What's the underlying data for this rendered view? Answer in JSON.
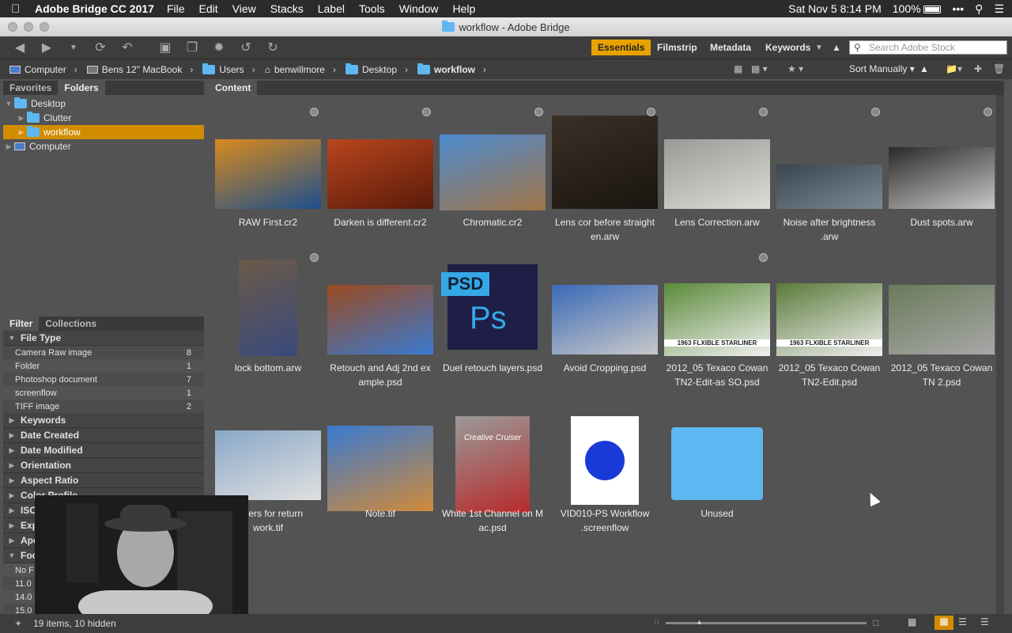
{
  "menubar": {
    "app_name": "Adobe Bridge CC 2017",
    "items": [
      "File",
      "Edit",
      "View",
      "Stacks",
      "Label",
      "Tools",
      "Window",
      "Help"
    ],
    "clock": "Sat Nov 5  8:14 PM",
    "battery": "100%"
  },
  "window": {
    "title": "workflow - Adobe Bridge"
  },
  "workspaces": {
    "essentials": "Essentials",
    "filmstrip": "Filmstrip",
    "metadata": "Metadata",
    "keywords": "Keywords"
  },
  "search": {
    "placeholder": "Search Adobe Stock"
  },
  "breadcrumbs": [
    "Computer",
    "Bens 12\" MacBook",
    "Users",
    "benwillmore",
    "Desktop",
    "workflow"
  ],
  "sort": {
    "label": "Sort Manually"
  },
  "left_panel": {
    "tabs": [
      "Favorites",
      "Folders"
    ],
    "tree": [
      "Desktop",
      "Clutter",
      "workflow",
      "Computer"
    ]
  },
  "filter_panel": {
    "tabs": [
      "Filter",
      "Collections"
    ],
    "file_type": {
      "title": "File Type",
      "rows": [
        {
          "label": "Camera Raw image",
          "count": "8"
        },
        {
          "label": "Folder",
          "count": "1"
        },
        {
          "label": "Photoshop document",
          "count": "7"
        },
        {
          "label": "screenflow",
          "count": "1"
        },
        {
          "label": "TIFF image",
          "count": "2"
        }
      ]
    },
    "sections": [
      "Keywords",
      "Date Created",
      "Date Modified",
      "Orientation",
      "Aspect Ratio",
      "Color Profile",
      "ISO Speed Ratings",
      "Exp",
      "Ape",
      "Foc"
    ],
    "focal_values": [
      "No F",
      "11.0",
      "14.0",
      "15.0"
    ]
  },
  "content": {
    "tab": "Content",
    "items": [
      {
        "name": "RAW First.cr2",
        "l2": "",
        "color": "#d98a1e",
        "color2": "#1d4f8c"
      },
      {
        "name": "Darken is different.cr2",
        "l2": "",
        "color": "#b8461d",
        "color2": "#5a1a0a"
      },
      {
        "name": "Chromatic.cr2",
        "l2": "",
        "color": "#4c8bd1",
        "color2": "#a27446"
      },
      {
        "name": "Lens cor before straight",
        "l2": "en.arw",
        "color": "#3b3026",
        "color2": "#1a1510"
      },
      {
        "name": "Lens Correction.arw",
        "l2": "",
        "color": "#9a9a96",
        "color2": "#dcdcd8"
      },
      {
        "name": "Noise after brightness",
        "l2": ".arw",
        "color": "#3a4550",
        "color2": "#7a8a95"
      },
      {
        "name": "Dust spots.arw",
        "l2": "",
        "color": "#2a2a2a",
        "color2": "#c8c8c8"
      },
      {
        "name": "lock bottom.arw",
        "l2": "",
        "color": "#6b5a48",
        "color2": "#3a4a7c"
      },
      {
        "name": "Retouch and Adj 2nd ex",
        "l2": "ample.psd",
        "color": "#9a4a20",
        "color2": "#3a7ad0"
      },
      {
        "name": "Duel retouch layers.psd",
        "l2": "",
        "color": "#1e1e46",
        "color2": "#35a8e8"
      },
      {
        "name": "Avoid Cropping.psd",
        "l2": "",
        "color": "#3a6ab8",
        "color2": "#c8c8c8"
      },
      {
        "name": "2012_05 Texaco Cowan",
        "l2": "TN2-Edit-as SO.psd",
        "color": "#5a8a3a",
        "color2": "#f0f0f0"
      },
      {
        "name": "2012_05 Texaco Cowan",
        "l2": "TN2-Edit.psd",
        "color": "#5a7a3a",
        "color2": "#f0f0f0"
      },
      {
        "name": "2012_05 Texaco Cowan",
        "l2": "TN 2.psd",
        "color": "#6a7a5a",
        "color2": "#a8a8a8"
      },
      {
        "name": "Layers for return",
        "l2": "work.tif",
        "color": "#8aa8c8",
        "color2": "#e0e0e0"
      },
      {
        "name": "Note.tif",
        "l2": "",
        "color": "#3a7ad0",
        "color2": "#d08a3a"
      },
      {
        "name": "White 1st Channel on M",
        "l2": "ac.psd",
        "color": "#9a9a9a",
        "color2": "#b82a2a"
      },
      {
        "name": "VID010-PS Workflow",
        "l2": ".screenflow",
        "color": "#ffffff",
        "color2": "#1a3ad8"
      },
      {
        "name": "Unused",
        "l2": "",
        "color": "#5db7f0",
        "color2": "#4aa8e0"
      }
    ],
    "psd_label": "PSD",
    "ps_label": "Ps",
    "texaco_caption": "1963 FLXIBLE STARLINER",
    "cruiser_text": "Creative Cruiser"
  },
  "status": {
    "items_text": "19 items, 10 hidden"
  },
  "colors": {
    "accent": "#e8a200",
    "selection": "#d18c00",
    "panel": "#535353"
  }
}
